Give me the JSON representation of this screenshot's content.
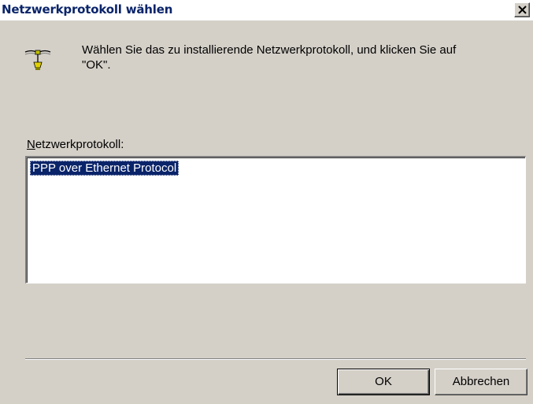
{
  "window": {
    "title": "Netzwerkprotokoll wählen",
    "close_icon": "close-icon"
  },
  "content": {
    "icon": "network-protocol-icon",
    "instruction_line1": "Wählen Sie das zu installierende Netzwerkprotokoll, und klicken Sie auf",
    "instruction_line2": "\"OK\".",
    "list_label_mnemonic": "N",
    "list_label_rest": "etzwerkprotokoll:",
    "list_items": [
      {
        "label": "PPP over Ethernet Protocol",
        "selected": true
      }
    ]
  },
  "buttons": {
    "ok_label": "OK",
    "cancel_label": "Abbrechen"
  },
  "colors": {
    "dialog_bg": "#d4d0c8",
    "selection_bg": "#0a246a",
    "title_text": "#0a246a"
  }
}
